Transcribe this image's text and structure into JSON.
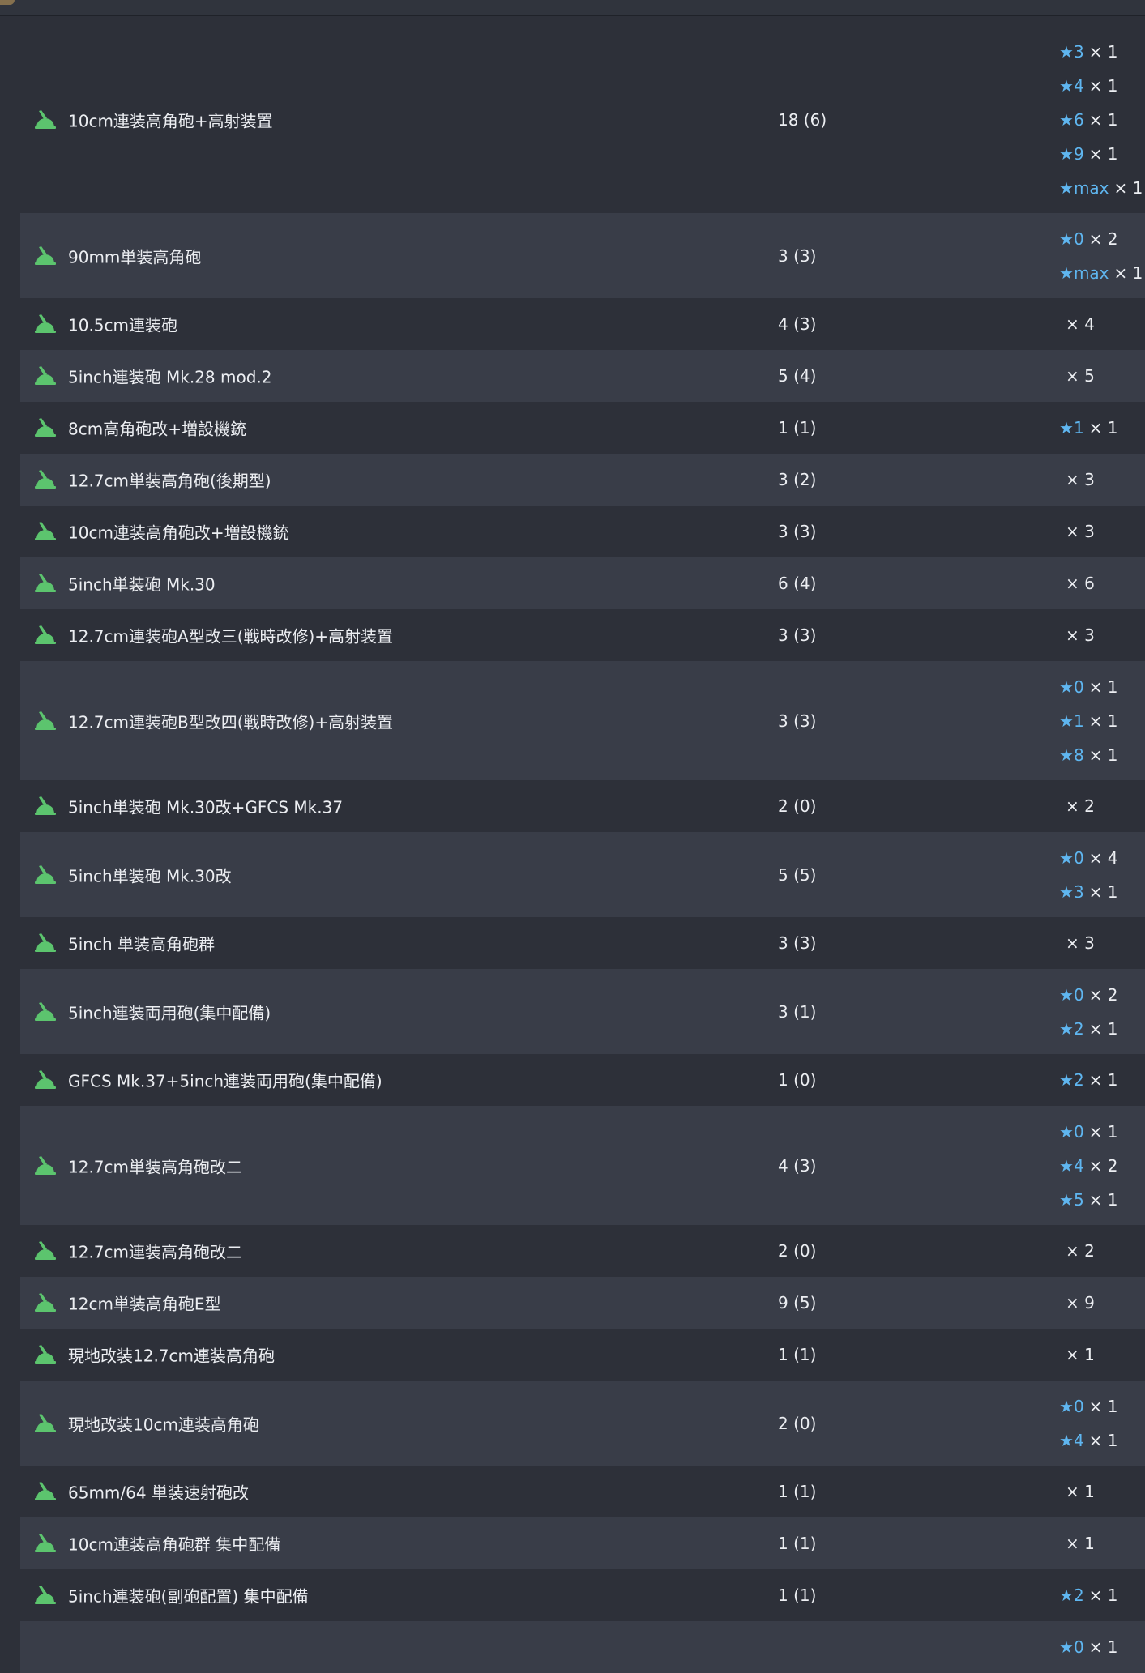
{
  "colors": {
    "background": "#2d3039",
    "row_alt": "#393d48",
    "star": "#5fb6f0",
    "icon_green": "#5cc46e",
    "text": "#eceef2"
  },
  "icon_name": "equipment-aa-gun-icon",
  "rows": [
    {
      "name": "10cm連装高角砲+高射装置",
      "count": "18 (6)",
      "mods": [
        {
          "star": "★",
          "lvl": "3",
          "mult": "× 1"
        },
        {
          "star": "★",
          "lvl": "4",
          "mult": "× 1"
        },
        {
          "star": "★",
          "lvl": "6",
          "mult": "× 1"
        },
        {
          "star": "★",
          "lvl": "9",
          "mult": "× 1"
        },
        {
          "star": "★",
          "lvl": "max",
          "mult": "× 1"
        }
      ]
    },
    {
      "name": "90mm単装高角砲",
      "count": "3 (3)",
      "mods": [
        {
          "star": "★",
          "lvl": "0",
          "mult": "× 2"
        },
        {
          "star": "★",
          "lvl": "max",
          "mult": "× 1"
        }
      ]
    },
    {
      "name": "10.5cm連装砲",
      "count": "4 (3)",
      "mods": [
        {
          "star": "",
          "lvl": "",
          "mult": "× 4"
        }
      ]
    },
    {
      "name": "5inch連装砲 Mk.28 mod.2",
      "count": "5 (4)",
      "mods": [
        {
          "star": "",
          "lvl": "",
          "mult": "× 5"
        }
      ]
    },
    {
      "name": "8cm高角砲改+増設機銃",
      "count": "1 (1)",
      "mods": [
        {
          "star": "★",
          "lvl": "1",
          "mult": "× 1"
        }
      ]
    },
    {
      "name": "12.7cm単装高角砲(後期型)",
      "count": "3 (2)",
      "mods": [
        {
          "star": "",
          "lvl": "",
          "mult": "× 3"
        }
      ]
    },
    {
      "name": "10cm連装高角砲改+増設機銃",
      "count": "3 (3)",
      "mods": [
        {
          "star": "",
          "lvl": "",
          "mult": "× 3"
        }
      ]
    },
    {
      "name": "5inch単装砲 Mk.30",
      "count": "6 (4)",
      "mods": [
        {
          "star": "",
          "lvl": "",
          "mult": "× 6"
        }
      ]
    },
    {
      "name": "12.7cm連装砲A型改三(戦時改修)+高射装置",
      "count": "3 (3)",
      "mods": [
        {
          "star": "",
          "lvl": "",
          "mult": "× 3"
        }
      ]
    },
    {
      "name": "12.7cm連装砲B型改四(戦時改修)+高射装置",
      "count": "3 (3)",
      "mods": [
        {
          "star": "★",
          "lvl": "0",
          "mult": "× 1"
        },
        {
          "star": "★",
          "lvl": "1",
          "mult": "× 1"
        },
        {
          "star": "★",
          "lvl": "8",
          "mult": "× 1"
        }
      ]
    },
    {
      "name": "5inch単装砲 Mk.30改+GFCS Mk.37",
      "count": "2 (0)",
      "mods": [
        {
          "star": "",
          "lvl": "",
          "mult": "× 2"
        }
      ]
    },
    {
      "name": "5inch単装砲 Mk.30改",
      "count": "5 (5)",
      "mods": [
        {
          "star": "★",
          "lvl": "0",
          "mult": "× 4"
        },
        {
          "star": "★",
          "lvl": "3",
          "mult": "× 1"
        }
      ]
    },
    {
      "name": "5inch 単装高角砲群",
      "count": "3 (3)",
      "mods": [
        {
          "star": "",
          "lvl": "",
          "mult": "× 3"
        }
      ]
    },
    {
      "name": "5inch連装両用砲(集中配備)",
      "count": "3 (1)",
      "mods": [
        {
          "star": "★",
          "lvl": "0",
          "mult": "× 2"
        },
        {
          "star": "★",
          "lvl": "2",
          "mult": "× 1"
        }
      ]
    },
    {
      "name": "GFCS Mk.37+5inch連装両用砲(集中配備)",
      "count": "1 (0)",
      "mods": [
        {
          "star": "★",
          "lvl": "2",
          "mult": "× 1"
        }
      ]
    },
    {
      "name": "12.7cm単装高角砲改二",
      "count": "4 (3)",
      "mods": [
        {
          "star": "★",
          "lvl": "0",
          "mult": "× 1"
        },
        {
          "star": "★",
          "lvl": "4",
          "mult": "× 2"
        },
        {
          "star": "★",
          "lvl": "5",
          "mult": "× 1"
        }
      ]
    },
    {
      "name": "12.7cm連装高角砲改二",
      "count": "2 (0)",
      "mods": [
        {
          "star": "",
          "lvl": "",
          "mult": "× 2"
        }
      ]
    },
    {
      "name": "12cm単装高角砲E型",
      "count": "9 (5)",
      "mods": [
        {
          "star": "",
          "lvl": "",
          "mult": "× 9"
        }
      ]
    },
    {
      "name": "現地改装12.7cm連装高角砲",
      "count": "1 (1)",
      "mods": [
        {
          "star": "",
          "lvl": "",
          "mult": "× 1"
        }
      ]
    },
    {
      "name": "現地改装10cm連装高角砲",
      "count": "2 (0)",
      "mods": [
        {
          "star": "★",
          "lvl": "0",
          "mult": "× 1"
        },
        {
          "star": "★",
          "lvl": "4",
          "mult": "× 1"
        }
      ]
    },
    {
      "name": "65mm/64 単装速射砲改",
      "count": "1 (1)",
      "mods": [
        {
          "star": "",
          "lvl": "",
          "mult": "× 1"
        }
      ]
    },
    {
      "name": "10cm連装高角砲群 集中配備",
      "count": "1 (1)",
      "mods": [
        {
          "star": "",
          "lvl": "",
          "mult": "× 1"
        }
      ]
    },
    {
      "name": "5inch連装砲(副砲配置) 集中配備",
      "count": "1 (1)",
      "mods": [
        {
          "star": "★",
          "lvl": "2",
          "mult": "× 1"
        }
      ]
    },
    {
      "name": "",
      "count": "",
      "mods": [
        {
          "star": "★",
          "lvl": "0",
          "mult": "× 1"
        }
      ]
    }
  ]
}
